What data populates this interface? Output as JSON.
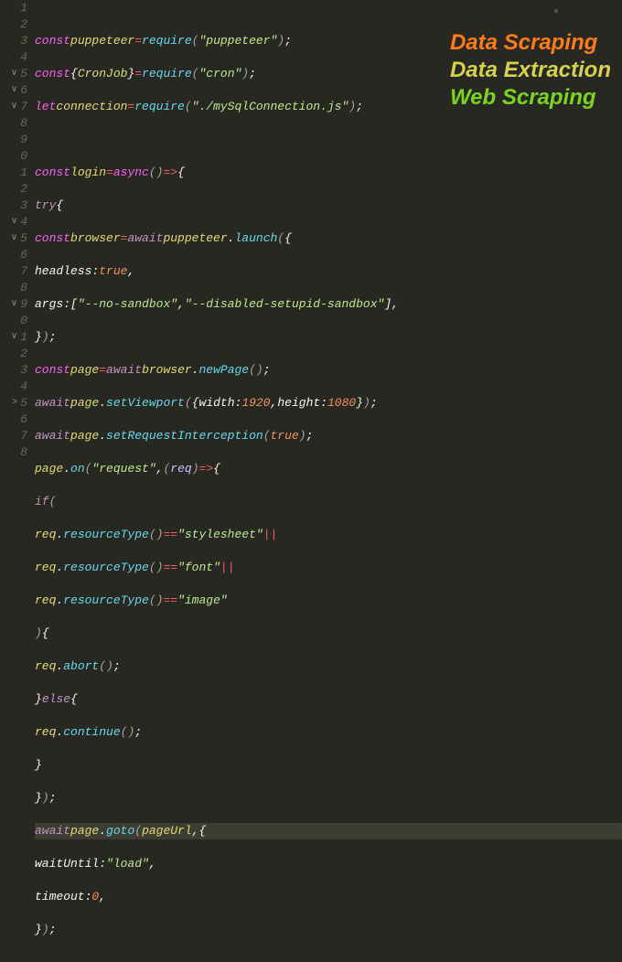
{
  "overlay": {
    "line1": "Data Scraping",
    "line2": "Data Extraction",
    "line3": "Web Scraping"
  },
  "gutter": [
    {
      "n": "1",
      "fold": ""
    },
    {
      "n": "2",
      "fold": ""
    },
    {
      "n": "3",
      "fold": ""
    },
    {
      "n": "4",
      "fold": ""
    },
    {
      "n": "5",
      "fold": "∨"
    },
    {
      "n": "6",
      "fold": "∨"
    },
    {
      "n": "7",
      "fold": "∨"
    },
    {
      "n": "8",
      "fold": ""
    },
    {
      "n": "9",
      "fold": ""
    },
    {
      "n": "0",
      "fold": ""
    },
    {
      "n": "1",
      "fold": ""
    },
    {
      "n": "2",
      "fold": ""
    },
    {
      "n": "3",
      "fold": ""
    },
    {
      "n": "4",
      "fold": "∨"
    },
    {
      "n": "5",
      "fold": "∨"
    },
    {
      "n": "6",
      "fold": ""
    },
    {
      "n": "7",
      "fold": ""
    },
    {
      "n": "8",
      "fold": ""
    },
    {
      "n": "9",
      "fold": "∨"
    },
    {
      "n": "0",
      "fold": ""
    },
    {
      "n": "1",
      "fold": "∨"
    },
    {
      "n": "2",
      "fold": ""
    },
    {
      "n": "3",
      "fold": ""
    },
    {
      "n": "4",
      "fold": ""
    },
    {
      "n": "5",
      "fold": ">"
    },
    {
      "n": "6",
      "fold": ""
    },
    {
      "n": "7",
      "fold": ""
    },
    {
      "n": "8",
      "fold": ""
    }
  ],
  "tok": {
    "const": "const",
    "let": "let",
    "require": "require",
    "async": "async",
    "try": "try",
    "await": "await",
    "if": "if",
    "else": "else",
    "true": "true",
    "puppeteer": "puppeteer",
    "CronJob": "CronJob",
    "connection": "connection",
    "login": "login",
    "browser": "browser",
    "page": "page",
    "req": "req",
    "pageUrl": "pageUrl",
    "launch": "launch",
    "newPage": "newPage",
    "setViewport": "setViewport",
    "setRequestInterception": "setRequestInterception",
    "on": "on",
    "resourceType": "resourceType",
    "abort": "abort",
    "continue": "continue",
    "goto": "goto",
    "headless": "headless",
    "args": "args",
    "width": "width",
    "height": "height",
    "waitUntil": "waitUntil",
    "timeout": "timeout",
    "s_puppeteer": "\"puppeteer\"",
    "s_cron": "\"cron\"",
    "s_conn": "\"./mySqlConnection.js\"",
    "s_nosand": "\"--no-sandbox\"",
    "s_dissand": "\"--disabled-setupid-sandbox\"",
    "s_request": "\"request\"",
    "s_stylesheet": "\"stylesheet\"",
    "s_font": "\"font\"",
    "s_image": "\"image\"",
    "s_load": "\"load\"",
    "n1920": "1920",
    "n1080": "1080",
    "n0": "0",
    "eq": "=",
    "arrow": "=>",
    "pipe": "||",
    "eqeq": "==",
    "lb": "{",
    "rb": "}",
    "lp": "(",
    "rp": ")",
    "lk": "[",
    "rk": "]",
    "semi": ";",
    "comma": ",",
    "colon": ":",
    "dot": "."
  }
}
